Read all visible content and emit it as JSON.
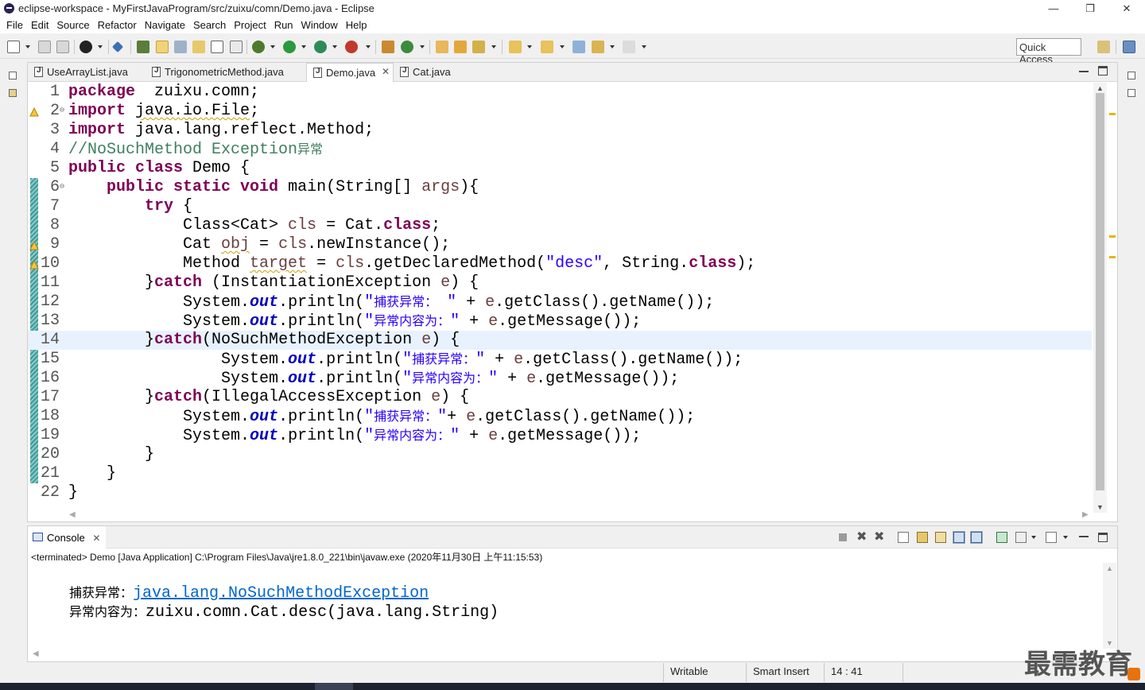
{
  "window": {
    "title": "eclipse-workspace - MyFirstJavaProgram/src/zuixu/comn/Demo.java - Eclipse",
    "minimize": "—",
    "restore": "❐",
    "close": "✕"
  },
  "menu": [
    "File",
    "Edit",
    "Source",
    "Refactor",
    "Navigate",
    "Search",
    "Project",
    "Run",
    "Window",
    "Help"
  ],
  "toolbar": {
    "quick_access": "Quick Access"
  },
  "editor": {
    "tabs": [
      {
        "label": "UseArrayList.java"
      },
      {
        "label": "TrigonometricMethod.java"
      },
      {
        "label": "Demo.java",
        "close": "✕"
      },
      {
        "label": "Cat.java"
      }
    ],
    "current_line": 14
  },
  "console": {
    "tab_label": "Console",
    "tab_close": "✕",
    "path": "<terminated> Demo [Java Application] C:\\Program Files\\Java\\jre1.8.0_221\\bin\\javaw.exe (2020年11月30日 上午11:15:53)",
    "out": [
      {
        "label": "捕获异常：",
        "value": "java.lang.NoSuchMethodException"
      },
      {
        "label": "异常内容为：",
        "value": "zuixu.comn.Cat.desc(java.lang.String)"
      }
    ]
  },
  "status": {
    "writable": "Writable",
    "insert_mode": "Smart Insert",
    "position": "14 : 41"
  },
  "watermark": "最需教育",
  "colors": {
    "keyword": "#7f0055",
    "comment": "#3f7f5f",
    "string": "#2a00ff",
    "field": "#0000c0",
    "variable": "#6a3e3e",
    "current_line": "#e8f2fe",
    "link": "#0066cc"
  },
  "icons": [
    "eclipse-logo-icon",
    "java-file-icon",
    "minimize-view-icon",
    "maximize-view-icon",
    "console-icon",
    "terminate-icon",
    "remove-launch-icon",
    "scroll-lock-icon",
    "pin-console-icon",
    "warning-marker-icon"
  ],
  "code": [
    {
      "n": "1",
      "fold": "",
      "parts": [
        [
          "k",
          "package"
        ],
        [
          "",
          "  zuixu.comn;"
        ]
      ]
    },
    {
      "n": "2",
      "fold": "⊖",
      "parts": [
        [
          "k",
          "import"
        ],
        [
          "",
          " "
        ],
        [
          "wv",
          "java.io.File"
        ],
        [
          "",
          ";"
        ]
      ]
    },
    {
      "n": "3",
      "fold": "",
      "parts": [
        [
          "k",
          "import"
        ],
        [
          "",
          " java.lang.reflect.Method;"
        ]
      ]
    },
    {
      "n": "4",
      "fold": "",
      "parts": [
        [
          "cm",
          "//NoSuchMethod Exception"
        ],
        [
          "cm cjk",
          "异常"
        ]
      ]
    },
    {
      "n": "5",
      "fold": "",
      "parts": [
        [
          "k",
          "public class"
        ],
        [
          "",
          " Demo {"
        ]
      ]
    },
    {
      "n": "6",
      "fold": "⊖",
      "parts": [
        [
          "",
          "    "
        ],
        [
          "k",
          "public static void"
        ],
        [
          "",
          " main(String[] "
        ],
        [
          "va",
          "args"
        ],
        [
          "",
          "){"
        ]
      ]
    },
    {
      "n": "7",
      "fold": "",
      "parts": [
        [
          "",
          "        "
        ],
        [
          "k",
          "try"
        ],
        [
          "",
          " {"
        ]
      ]
    },
    {
      "n": "8",
      "fold": "",
      "parts": [
        [
          "",
          "            Class<Cat> "
        ],
        [
          "va",
          "cls"
        ],
        [
          "",
          " = Cat."
        ],
        [
          "k",
          "class"
        ],
        [
          "",
          ";"
        ]
      ]
    },
    {
      "n": "9",
      "fold": "",
      "parts": [
        [
          "",
          "            Cat "
        ],
        [
          "va wv",
          "obj"
        ],
        [
          "",
          " = "
        ],
        [
          "va",
          "cls"
        ],
        [
          "",
          ".newInstance();"
        ]
      ]
    },
    {
      "n": "10",
      "fold": "",
      "parts": [
        [
          "",
          "            Method "
        ],
        [
          "va wv",
          "target"
        ],
        [
          "",
          " = "
        ],
        [
          "va",
          "cls"
        ],
        [
          "",
          ".getDeclaredMethod("
        ],
        [
          "st",
          "\"desc\""
        ],
        [
          "",
          ", String."
        ],
        [
          "k",
          "class"
        ],
        [
          "",
          ");"
        ]
      ]
    },
    {
      "n": "11",
      "fold": "",
      "parts": [
        [
          "",
          "        }"
        ],
        [
          "k",
          "catch"
        ],
        [
          "",
          " (InstantiationException "
        ],
        [
          "va",
          "e"
        ],
        [
          "",
          ") {"
        ]
      ]
    },
    {
      "n": "12",
      "fold": "",
      "parts": [
        [
          "",
          "            System."
        ],
        [
          "fld",
          "out"
        ],
        [
          "",
          ".println("
        ],
        [
          "st",
          "\""
        ],
        [
          "st cjk",
          "捕获异常："
        ],
        [
          "st",
          " \""
        ],
        [
          "",
          " + "
        ],
        [
          "va",
          "e"
        ],
        [
          "",
          ".getClass().getName());"
        ]
      ]
    },
    {
      "n": "13",
      "fold": "",
      "parts": [
        [
          "",
          "            System."
        ],
        [
          "fld",
          "out"
        ],
        [
          "",
          ".println("
        ],
        [
          "st",
          "\""
        ],
        [
          "st cjk",
          "异常内容为："
        ],
        [
          "st",
          "\""
        ],
        [
          "",
          " + "
        ],
        [
          "va",
          "e"
        ],
        [
          "",
          ".getMessage());"
        ]
      ]
    },
    {
      "n": "14",
      "fold": "",
      "parts": [
        [
          "",
          "        }"
        ],
        [
          "k",
          "catch"
        ],
        [
          "",
          "(NoSuchMethodException "
        ],
        [
          "va",
          "e"
        ],
        [
          "",
          ") {"
        ]
      ]
    },
    {
      "n": "15",
      "fold": "",
      "parts": [
        [
          "",
          "                System."
        ],
        [
          "fld",
          "out"
        ],
        [
          "",
          ".println("
        ],
        [
          "st",
          "\""
        ],
        [
          "st cjk",
          "捕获异常："
        ],
        [
          "st",
          "\""
        ],
        [
          "",
          " + "
        ],
        [
          "va",
          "e"
        ],
        [
          "",
          ".getClass().getName());"
        ]
      ]
    },
    {
      "n": "16",
      "fold": "",
      "parts": [
        [
          "",
          "                System."
        ],
        [
          "fld",
          "out"
        ],
        [
          "",
          ".println("
        ],
        [
          "st",
          "\""
        ],
        [
          "st cjk",
          "异常内容为："
        ],
        [
          "st",
          "\""
        ],
        [
          "",
          " + "
        ],
        [
          "va",
          "e"
        ],
        [
          "",
          ".getMessage());"
        ]
      ]
    },
    {
      "n": "17",
      "fold": "",
      "parts": [
        [
          "",
          "        }"
        ],
        [
          "k",
          "catch"
        ],
        [
          "",
          "(IllegalAccessException "
        ],
        [
          "va",
          "e"
        ],
        [
          "",
          ") {"
        ]
      ]
    },
    {
      "n": "18",
      "fold": "",
      "parts": [
        [
          "",
          "            System."
        ],
        [
          "fld",
          "out"
        ],
        [
          "",
          ".println("
        ],
        [
          "st",
          "\""
        ],
        [
          "st cjk",
          "捕获异常："
        ],
        [
          "st",
          "\""
        ],
        [
          "",
          "+ "
        ],
        [
          "va",
          "e"
        ],
        [
          "",
          ".getClass().getName());"
        ]
      ]
    },
    {
      "n": "19",
      "fold": "",
      "parts": [
        [
          "",
          "            System."
        ],
        [
          "fld",
          "out"
        ],
        [
          "",
          ".println("
        ],
        [
          "st",
          "\""
        ],
        [
          "st cjk",
          "异常内容为："
        ],
        [
          "st",
          "\""
        ],
        [
          "",
          " + "
        ],
        [
          "va",
          "e"
        ],
        [
          "",
          ".getMessage());"
        ]
      ]
    },
    {
      "n": "20",
      "fold": "",
      "parts": [
        [
          "",
          "        }"
        ]
      ]
    },
    {
      "n": "21",
      "fold": "",
      "parts": [
        [
          "",
          "    }"
        ]
      ]
    },
    {
      "n": "22",
      "fold": "",
      "parts": [
        [
          "",
          "}"
        ]
      ]
    }
  ]
}
